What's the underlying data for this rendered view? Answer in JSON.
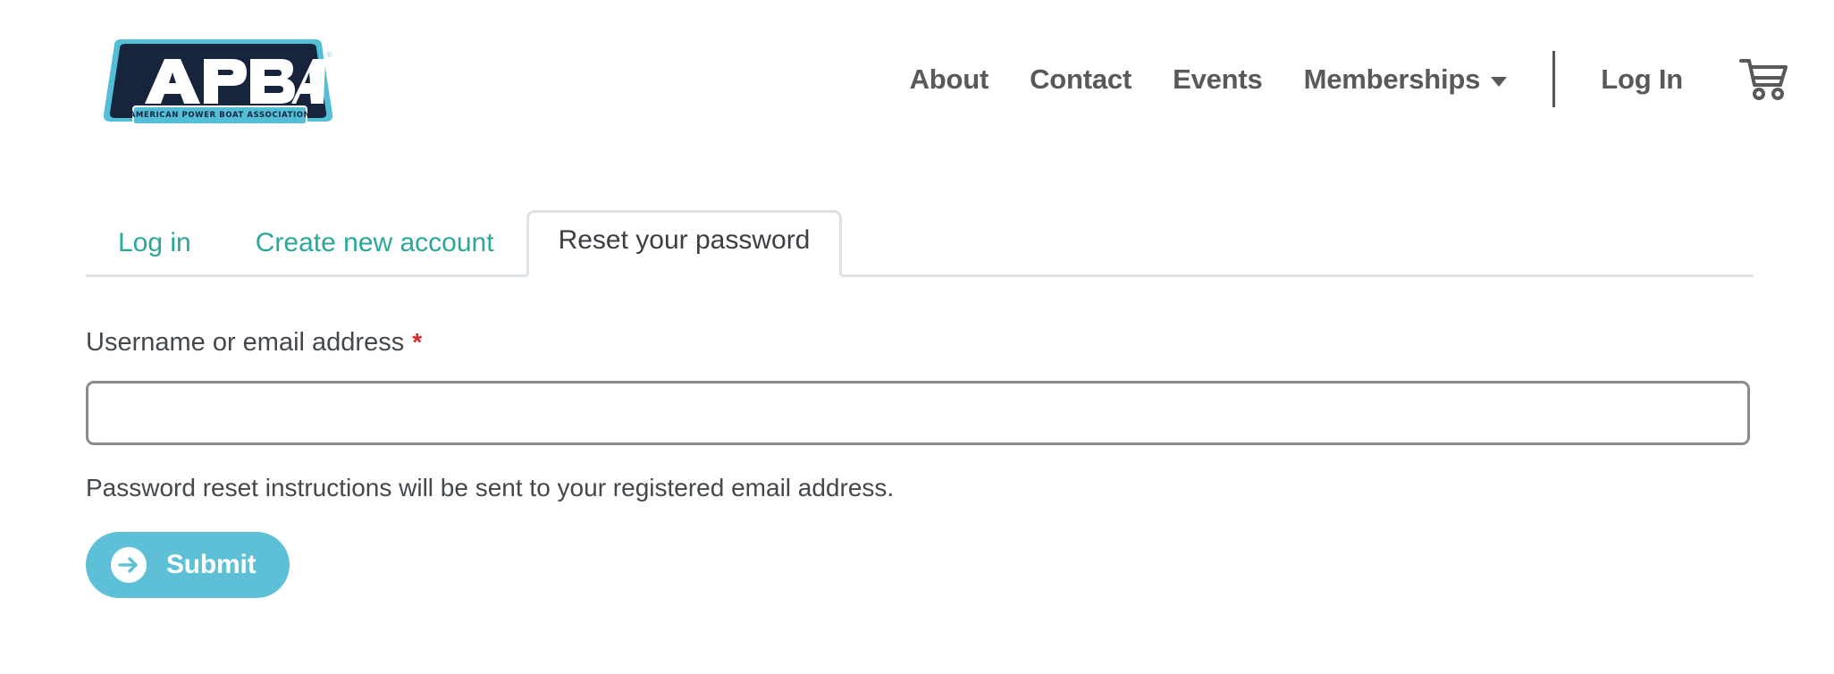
{
  "header": {
    "logo": {
      "name": "apba-logo",
      "wordmark": "APBA",
      "subtitle": "AMERICAN POWER BOAT ASSOCIATION",
      "trademark": "®",
      "navy": "#16243c",
      "teal": "#53bfd6"
    },
    "nav_items": [
      {
        "label": "About",
        "icon": ""
      },
      {
        "label": "Contact",
        "icon": ""
      },
      {
        "label": "Events",
        "icon": ""
      },
      {
        "label": "Memberships",
        "icon": "chevron-down-icon"
      }
    ],
    "account_label": "Log In",
    "cart_icon": "shopping-cart-icon",
    "nav_text_color": "#595959",
    "divider_color": "#555555"
  },
  "tabs": [
    {
      "label": "Log in",
      "active": false
    },
    {
      "label": "Create new account",
      "active": false
    },
    {
      "label": "Reset your password",
      "active": true
    }
  ],
  "tab_colors": {
    "link": "#2aa79b",
    "active_text": "#3b3f44",
    "border": "#dde2e6"
  },
  "form": {
    "field_label": "Username or email address",
    "required_marker": "*",
    "required_color": "#e02424",
    "input": {
      "name": "username-or-email-input",
      "value": "",
      "placeholder": ""
    },
    "help_text": "Password reset instructions will be sent to your registered email address.",
    "submit_label": "Submit",
    "submit_icon": "arrow-right-circle-icon",
    "submit_color": "#5ec0d6"
  }
}
